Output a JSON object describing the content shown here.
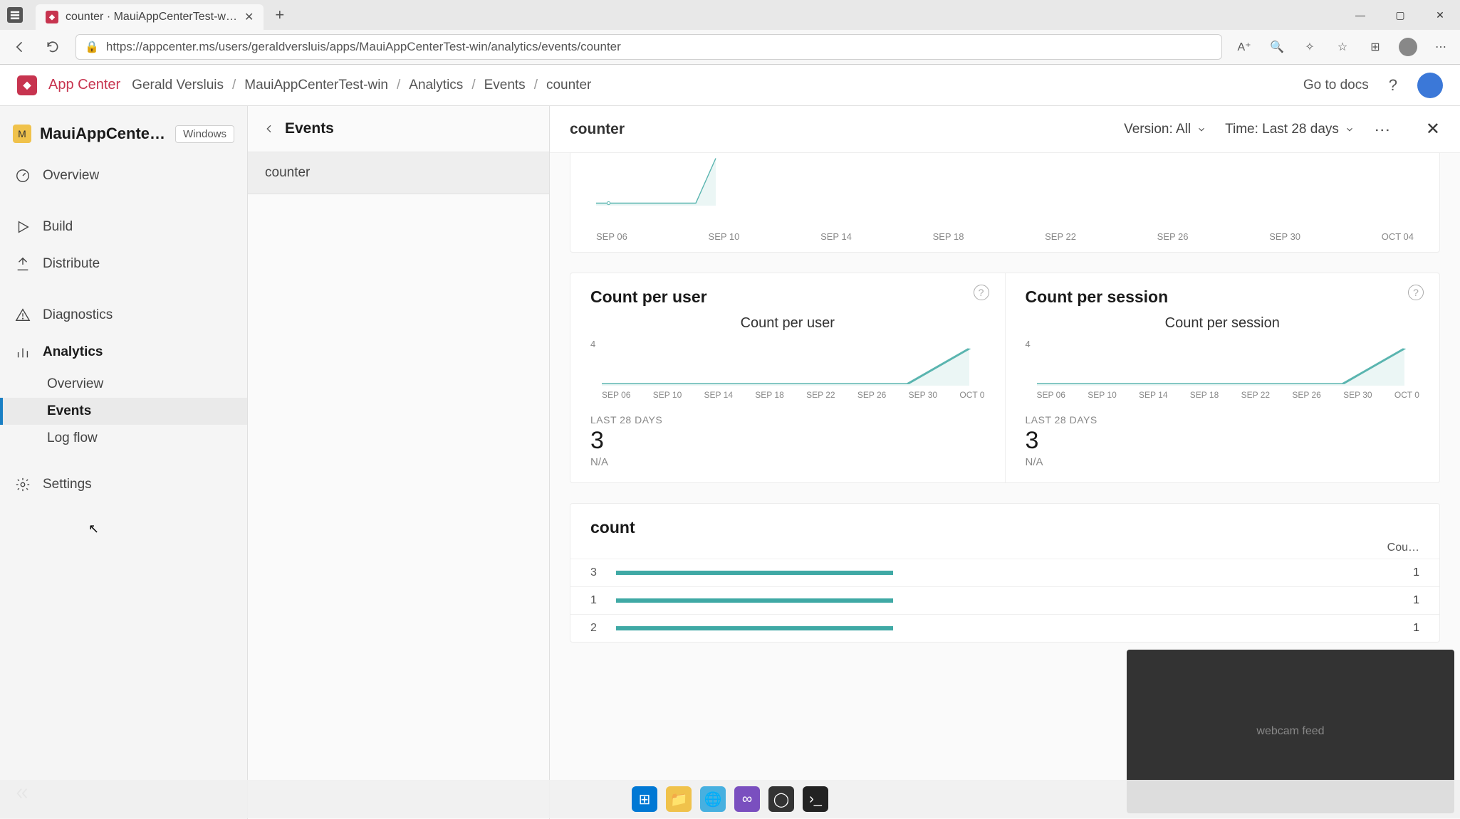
{
  "browser": {
    "tab_title": "counter · MauiAppCenterTest-w…",
    "url": "https://appcenter.ms/users/geraldversluis/apps/MauiAppCenterTest-win/analytics/events/counter"
  },
  "header": {
    "brand": "App Center",
    "breadcrumb": [
      "Gerald Versluis",
      "MauiAppCenterTest-win",
      "Analytics",
      "Events",
      "counter"
    ],
    "docs": "Go to docs"
  },
  "sidebar": {
    "app_name": "MauiAppCente…",
    "platform": "Windows",
    "items": {
      "overview": "Overview",
      "build": "Build",
      "distribute": "Distribute",
      "diagnostics": "Diagnostics",
      "analytics": "Analytics",
      "settings": "Settings"
    },
    "analytics_sub": {
      "overview": "Overview",
      "events": "Events",
      "logflow": "Log flow"
    }
  },
  "events": {
    "title": "Events",
    "list": [
      "counter"
    ]
  },
  "detail": {
    "title": "counter",
    "filter_version": "Version: All",
    "filter_time": "Time: Last 28 days"
  },
  "chart_data": [
    {
      "type": "line",
      "title": "",
      "x_ticks": [
        "SEP 06",
        "SEP 10",
        "SEP 14",
        "SEP 18",
        "SEP 22",
        "SEP 26",
        "SEP 30",
        "OCT 04"
      ],
      "series": [
        {
          "name": "counter",
          "values": [
            0,
            0,
            0,
            0,
            0,
            0,
            0,
            3
          ]
        }
      ]
    },
    {
      "type": "line",
      "panel_title": "Count per user",
      "title": "Count per user",
      "ymax": 4,
      "x_ticks": [
        "SEP 06",
        "SEP 10",
        "SEP 14",
        "SEP 18",
        "SEP 22",
        "SEP 26",
        "SEP 30",
        "OCT 0"
      ],
      "series": [
        {
          "name": "count_per_user",
          "values": [
            0,
            0,
            0,
            0,
            0,
            0,
            0,
            3
          ]
        }
      ],
      "stat_label": "LAST 28 DAYS",
      "stat_value": "3",
      "stat_sub": "N/A"
    },
    {
      "type": "line",
      "panel_title": "Count per session",
      "title": "Count per session",
      "ymax": 4,
      "x_ticks": [
        "SEP 06",
        "SEP 10",
        "SEP 14",
        "SEP 18",
        "SEP 22",
        "SEP 26",
        "SEP 30",
        "OCT 0"
      ],
      "series": [
        {
          "name": "count_per_session",
          "values": [
            0,
            0,
            0,
            0,
            0,
            0,
            0,
            3
          ]
        }
      ],
      "stat_label": "LAST 28 DAYS",
      "stat_value": "3",
      "stat_sub": "N/A"
    },
    {
      "type": "bar",
      "title": "count",
      "count_header": "Cou…",
      "rows": [
        {
          "key": "3",
          "value": 1,
          "pct": 36
        },
        {
          "key": "1",
          "value": 1,
          "pct": 36
        },
        {
          "key": "2",
          "value": 1,
          "pct": 36
        }
      ]
    }
  ],
  "taskbar": {
    "colors": [
      "#0078d4",
      "#f0c24b",
      "#47b0e0",
      "#7a4fbf",
      "#333",
      "#222"
    ]
  }
}
